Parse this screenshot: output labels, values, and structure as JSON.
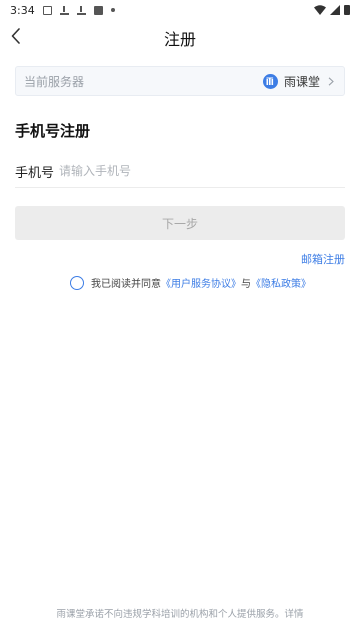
{
  "status_bar": {
    "time": "3:34"
  },
  "header": {
    "title": "注册"
  },
  "server": {
    "label": "当前服务器",
    "name": "雨课堂"
  },
  "section": {
    "title": "手机号注册"
  },
  "phone": {
    "label": "手机号",
    "placeholder": "请输入手机号",
    "value": ""
  },
  "next_button": {
    "label": "下一步"
  },
  "email_register": {
    "label": "邮箱注册"
  },
  "agreement": {
    "prefix": "我已阅读并同意",
    "user_agreement": "《用户服务协议》",
    "connector": "与",
    "privacy_policy": "《隐私政策》"
  },
  "footer": {
    "text": "雨课堂承诺不向违规学科培训的机构和个人提供服务。详情"
  },
  "colors": {
    "accent": "#3d7de5",
    "disabled_button": "#ececec"
  }
}
